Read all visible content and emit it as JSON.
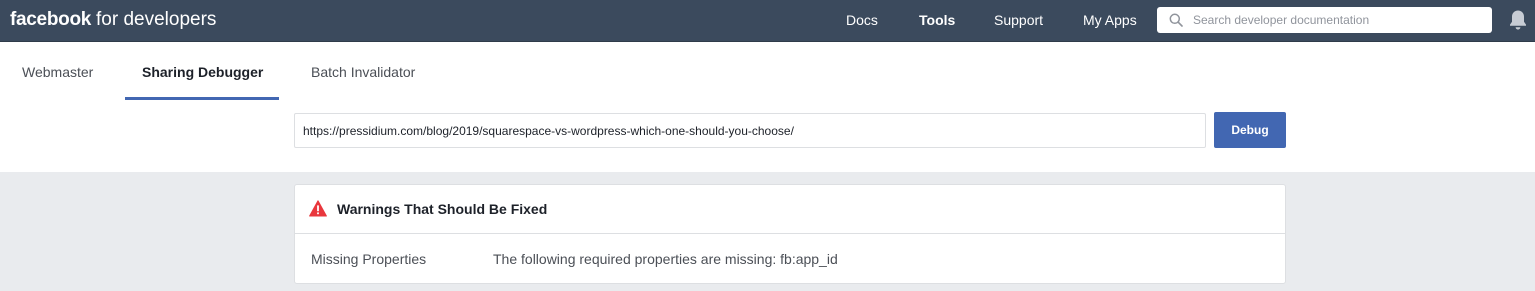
{
  "header": {
    "brand_bold": "facebook",
    "brand_rest": "for developers",
    "nav": [
      {
        "label": "Docs",
        "active": false
      },
      {
        "label": "Tools",
        "active": true
      },
      {
        "label": "Support",
        "active": false
      },
      {
        "label": "My Apps",
        "active": false
      }
    ],
    "search_placeholder": "Search developer documentation"
  },
  "tabs": [
    {
      "label": "Webmaster",
      "active": false
    },
    {
      "label": "Sharing Debugger",
      "active": true
    },
    {
      "label": "Batch Invalidator",
      "active": false
    }
  ],
  "debugger": {
    "url_value": "https://pressidium.com/blog/2019/squarespace-vs-wordpress-which-one-should-you-choose/",
    "debug_label": "Debug"
  },
  "warnings": {
    "title": "Warnings That Should Be Fixed",
    "rows": [
      {
        "label": "Missing Properties",
        "value": "The following required properties are missing: fb:app_id"
      }
    ]
  },
  "colors": {
    "topbar": "#3b4a5d",
    "accent": "#4267b2",
    "warning": "#e9373d",
    "page_bg": "#e9ebee"
  }
}
